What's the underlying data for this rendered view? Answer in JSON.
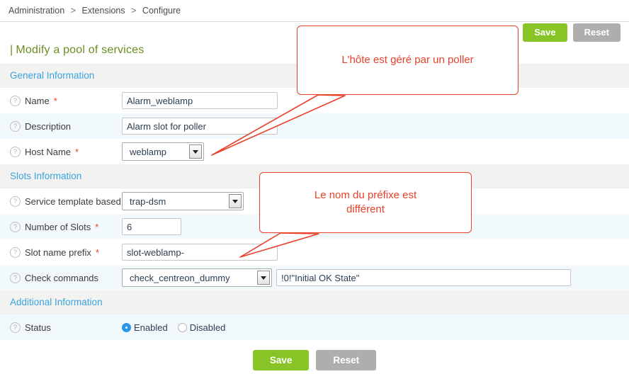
{
  "breadcrumb": {
    "items": [
      "Administration",
      "Extensions",
      "Configure"
    ],
    "separator": ">"
  },
  "toolbar": {
    "save_label": "Save",
    "reset_label": "Reset"
  },
  "page": {
    "title_bar": "|",
    "title": "Modify a pool of services"
  },
  "sections": {
    "general": {
      "header": "General Information",
      "name_label": "Name",
      "name_required": "*",
      "name_value": "Alarm_weblamp",
      "description_label": "Description",
      "description_value": "Alarm slot for poller",
      "host_label": "Host Name",
      "host_required": "*",
      "host_value": "weblamp"
    },
    "slots": {
      "header": "Slots Information",
      "template_label": "Service template based",
      "template_value": "trap-dsm",
      "number_label": "Number of Slots",
      "number_required": "*",
      "number_value": "6",
      "prefix_label": "Slot name prefix",
      "prefix_required": "*",
      "prefix_value": "slot-weblamp-",
      "check_label": "Check commands",
      "check_value": "check_centreon_dummy",
      "check_args_value": "!0!\"Initial OK State\""
    },
    "additional": {
      "header": "Additional Information",
      "status_label": "Status",
      "enabled_label": "Enabled",
      "disabled_label": "Disabled",
      "status_selected": "Enabled"
    }
  },
  "footer": {
    "save_label": "Save",
    "reset_label": "Reset"
  },
  "annotations": {
    "poller": "L'hôte est géré par un poller",
    "prefix_line1": "Le nom du préfixe est",
    "prefix_line2": "différent"
  },
  "icons": {
    "help": "?"
  },
  "colors": {
    "save": "#88c425",
    "reset": "#aeaeae",
    "section_header_text": "#3ba4dd",
    "title": "#6b8e23",
    "required": "#e8402a",
    "annotation": "#e8402a",
    "radio_on": "#2a96ea"
  }
}
